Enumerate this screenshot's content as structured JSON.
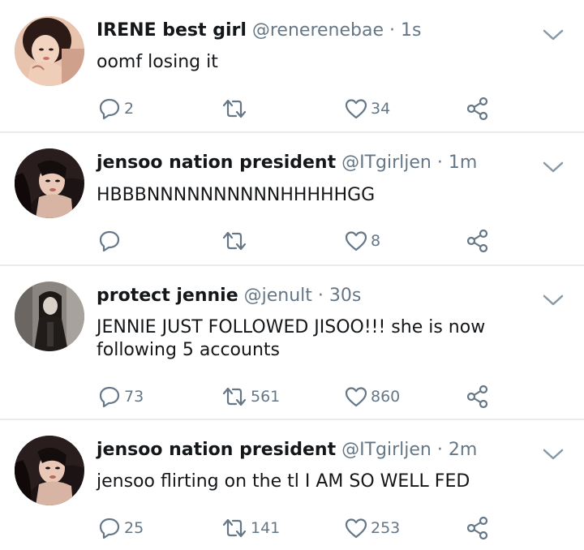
{
  "tweets": [
    {
      "name": "IRENE best girl",
      "handle": "@renerenebae",
      "separator": "·",
      "time": "1s",
      "text": "oomf losing it",
      "replies": "2",
      "retweets": "",
      "likes": "34",
      "avatar_icon": "profile-photo"
    },
    {
      "name": "jensoo nation president",
      "handle": "@ITgirljen",
      "separator": "·",
      "time": "1m",
      "text": "HBBBNNNNNNNNNNHHHHHGG",
      "replies": "",
      "retweets": "",
      "likes": "8",
      "avatar_icon": "profile-photo"
    },
    {
      "name": "protect jennie",
      "handle": "@jenult",
      "separator": "·",
      "time": "30s",
      "text": "JENNIE JUST FOLLOWED JISOO!!! she is now following 5 accounts",
      "replies": "73",
      "retweets": "561",
      "likes": "860",
      "avatar_icon": "profile-photo"
    },
    {
      "name": "jensoo nation president",
      "handle": "@ITgirljen",
      "separator": "·",
      "time": "2m",
      "text": "jensoo flirting on the tl I AM SO WELL FED",
      "replies": "25",
      "retweets": "141",
      "likes": "253",
      "avatar_icon": "profile-photo"
    }
  ],
  "colors": {
    "text": "#14171a",
    "secondary": "#657786",
    "divider": "#e6ecf0",
    "background": "#ffffff"
  },
  "icons": [
    "chevron-down-icon",
    "reply-icon",
    "retweet-icon",
    "like-icon",
    "share-icon"
  ]
}
